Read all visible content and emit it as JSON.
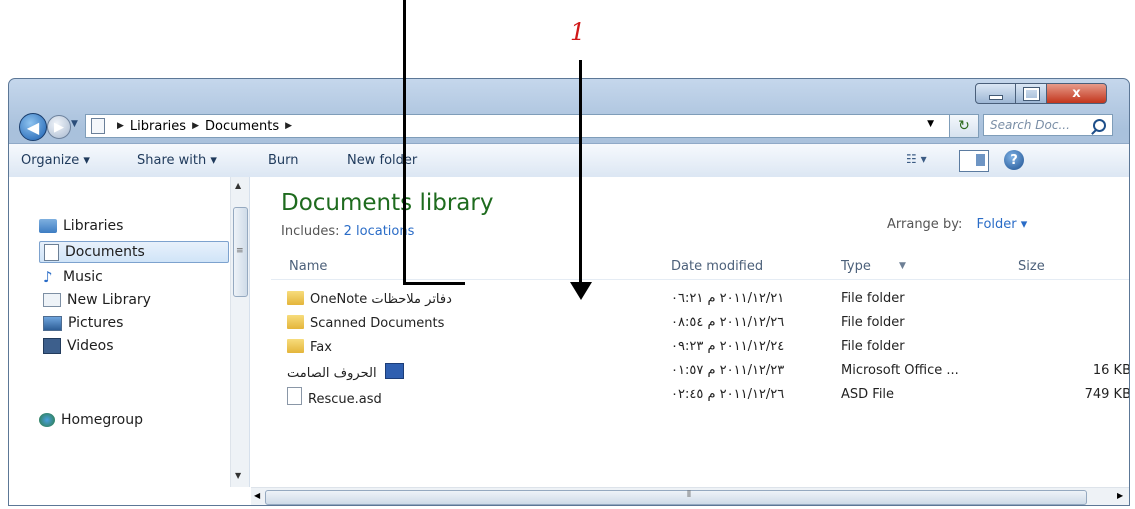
{
  "annotation": {
    "number": "1"
  },
  "window": {
    "controls": {
      "minimize": "minimize",
      "maximize": "maximize",
      "close": "x"
    }
  },
  "address_bar": {
    "breadcrumbs": [
      "Libraries",
      "Documents"
    ],
    "search_placeholder": "Search Doc..."
  },
  "toolbar": {
    "organize": "Organize ▾",
    "share_with": "Share with ▾",
    "burn": "Burn",
    "new_folder": "New folder",
    "help": "?"
  },
  "nav_pane": {
    "items": [
      {
        "label": "Libraries",
        "icon": "library-icon"
      },
      {
        "label": "Documents",
        "icon": "document-icon",
        "selected": true
      },
      {
        "label": "Music",
        "icon": "music-icon"
      },
      {
        "label": "New Library",
        "icon": "library-icon"
      },
      {
        "label": "Pictures",
        "icon": "pictures-icon"
      },
      {
        "label": "Videos",
        "icon": "videos-icon"
      },
      {
        "label": "Homegroup",
        "icon": "homegroup-icon"
      }
    ]
  },
  "library_header": {
    "title": "Documents library",
    "includes_label": "Includes:",
    "includes_link": "2 locations",
    "arrange_by_label": "Arrange by:",
    "arrange_by_value": "Folder ▾"
  },
  "columns": {
    "name": "Name",
    "date": "Date modified",
    "type": "Type",
    "size": "Size"
  },
  "files": [
    {
      "name": "OneNote دفاتر ملاحظات",
      "date": "٢٠١١/١٢/٢١ م ٠٦:٢١",
      "type": "File folder",
      "size": "",
      "icon": "folder-icon"
    },
    {
      "name": "Scanned Documents",
      "date": "٢٠١١/١٢/٢٦ م ٠٨:٥٤",
      "type": "File folder",
      "size": "",
      "icon": "folder-icon"
    },
    {
      "name": "Fax",
      "date": "٢٠١١/١٢/٢٤ م ٠٩:٢٣",
      "type": "File folder",
      "size": "",
      "icon": "folder-icon"
    },
    {
      "name": "الحروف الصامت",
      "date": "٢٠١١/١٢/٢٣ م ٠١:٥٧",
      "type": "Microsoft Office ...",
      "size": "16 KB",
      "icon": "word-document-icon"
    },
    {
      "name": "Rescue.asd",
      "date": "٢٠١١/١٢/٢٦ م ٠٢:٤٥",
      "type": "ASD File",
      "size": "749 KB",
      "icon": "file-icon"
    }
  ]
}
